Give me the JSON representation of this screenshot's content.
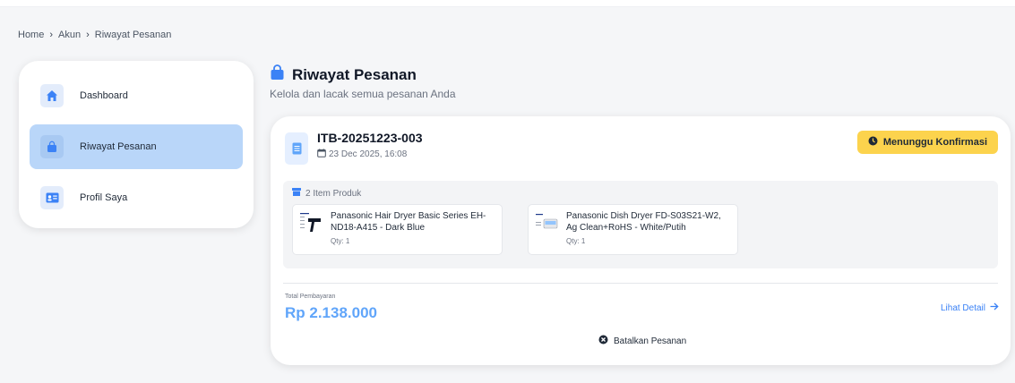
{
  "breadcrumb": {
    "home": "Home",
    "account": "Akun",
    "current": "Riwayat Pesanan",
    "separator": "›"
  },
  "sidebar": {
    "items": [
      {
        "label": "Dashboard",
        "icon": "home-icon",
        "active": false
      },
      {
        "label": "Riwayat Pesanan",
        "icon": "shopping-bag-icon",
        "active": true
      },
      {
        "label": "Profil Saya",
        "icon": "id-card-icon",
        "active": false
      }
    ]
  },
  "header": {
    "title": "Riwayat Pesanan",
    "subtitle": "Kelola dan lacak semua pesanan Anda",
    "icon": "shopping-bag-icon"
  },
  "order": {
    "id": "ITB-20251223-003",
    "date": "23 Dec 2025, 16:08",
    "status": "Menunggu Konfirmasi",
    "items_label": "2 Item Produk",
    "products": [
      {
        "name": "Panasonic Hair Dryer Basic Series EH-ND18-A415 - Dark Blue",
        "qty": "Qty: 1"
      },
      {
        "name": "Panasonic Dish Dryer FD-S03S21-W2, Ag Clean+RoHS - White/Putih",
        "qty": "Qty: 1"
      }
    ],
    "total_label": "Total Pembayaran",
    "total_value": "Rp 2.138.000",
    "detail_link": "Lihat Detail",
    "cancel_label": "Batalkan Pesanan"
  },
  "colors": {
    "accent": "#60a5fa",
    "link": "#3b82f6",
    "active_bg": "#b9d6f9",
    "status_bg": "#fcd34d"
  }
}
